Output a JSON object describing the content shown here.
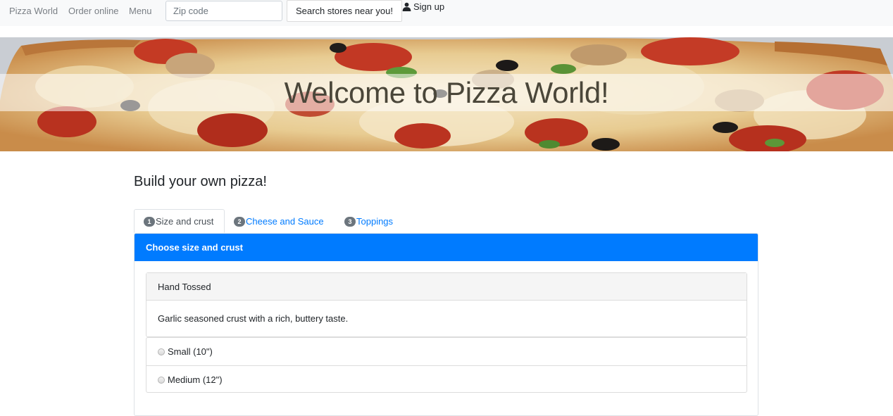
{
  "nav": {
    "brand": "Pizza World",
    "order": "Order online",
    "menu": "Menu",
    "zip_placeholder": "Zip code",
    "search_label": "Search stores near you!",
    "signup_label": "Sign up",
    "signup_icon": "user-icon"
  },
  "hero": {
    "title": "Welcome to Pizza World!"
  },
  "builder": {
    "title": "Build your own pizza!",
    "tabs": [
      {
        "num": "1",
        "label": "Size and crust",
        "active": true
      },
      {
        "num": "2",
        "label": "Cheese and Sauce",
        "active": false
      },
      {
        "num": "3",
        "label": "Toppings",
        "active": false
      }
    ],
    "card_header": "Choose size and crust",
    "crust": {
      "name": "Hand Tossed",
      "description": "Garlic seasoned crust with a rich, buttery taste."
    },
    "sizes": [
      {
        "label": "Small (10\")"
      },
      {
        "label": "Medium (12\")"
      }
    ]
  },
  "colors": {
    "primary": "#007bff",
    "navbar_bg": "#f8f9fa",
    "nav_text": "#7a7f85",
    "hero_text": "#4a4639"
  }
}
